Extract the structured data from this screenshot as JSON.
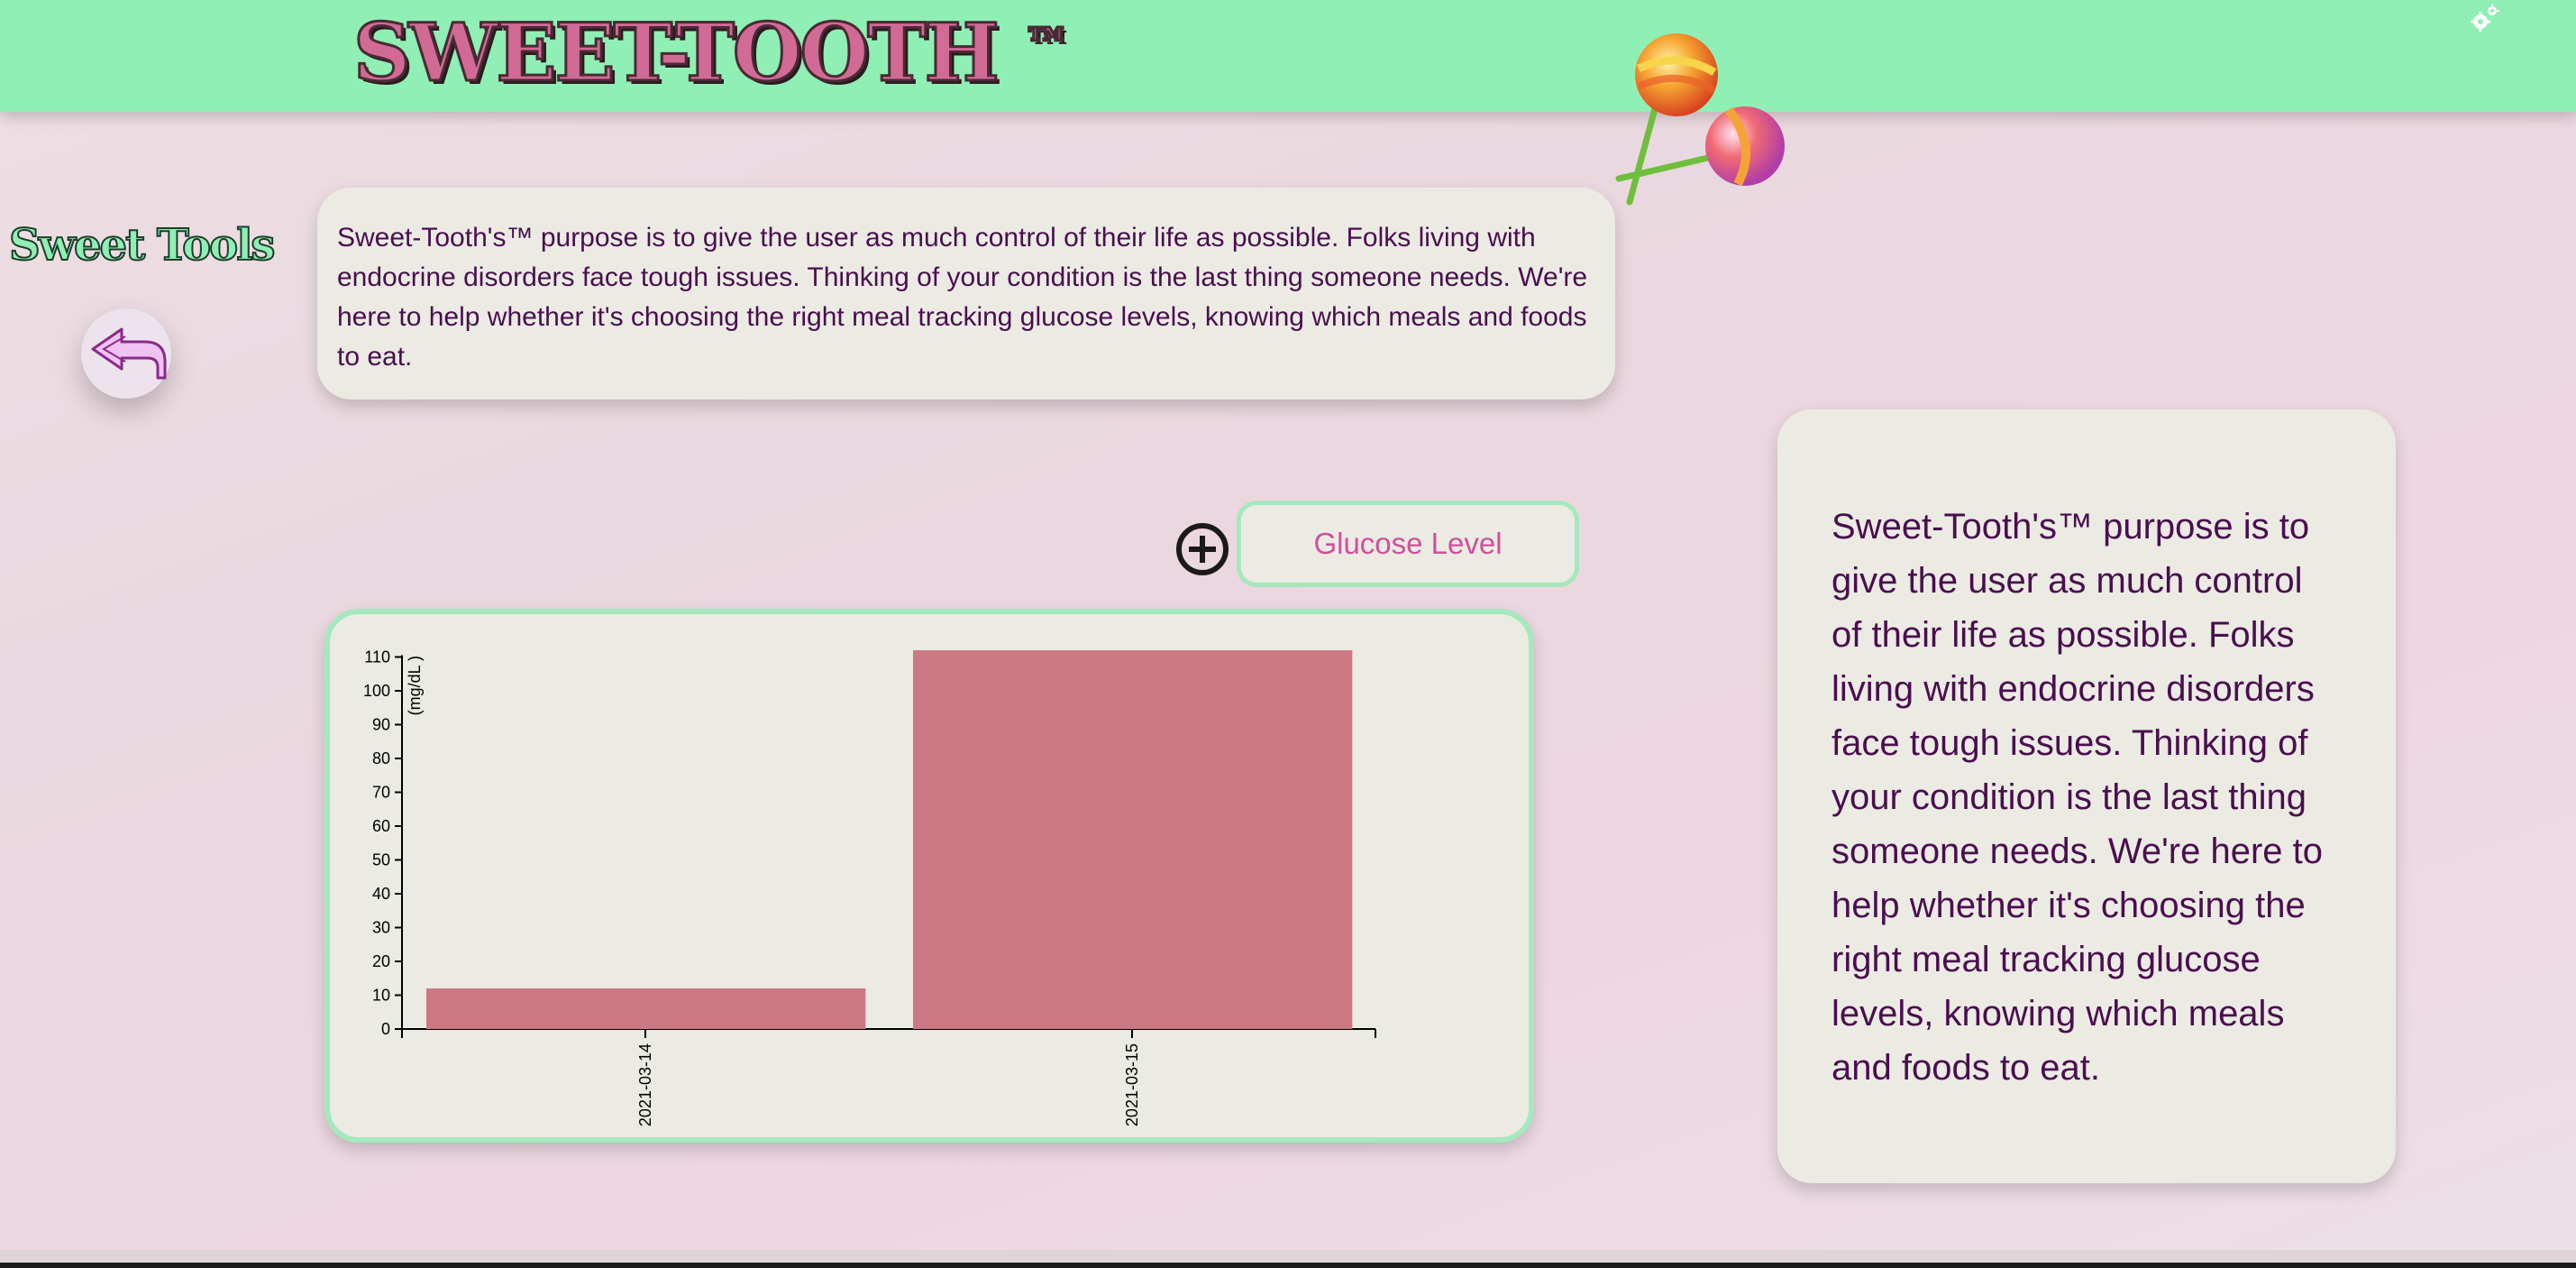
{
  "header": {
    "brand": "SWEET-TOOTH",
    "trademark": "™",
    "settings_icon": "gears-icon",
    "decoration": "lollipops"
  },
  "sidebar": {
    "title": "Sweet Tools",
    "back_icon": "back-arrow-icon"
  },
  "intro_card": {
    "text": "Sweet-Tooth's™ purpose is to give the user as much control of their life as possible. Folks living with endocrine disorders face tough issues. Thinking of your condition is the last thing someone needs. We're here to help whether it's choosing the right meal tracking glucose levels, knowing which meals and foods to eat."
  },
  "controls": {
    "add_icon": "plus-circle-icon",
    "glucose_button": "Glucose Level"
  },
  "side_card": {
    "text": "Sweet-Tooth's™ purpose is to give the user as much control of their life as possible. Folks living with endocrine disorders face tough issues. Thinking of your condition is the last thing someone needs. We're here to help whether it's choosing the right meal tracking glucose levels, knowing which meals and foods to eat."
  },
  "colors": {
    "header": "#8fefb4",
    "bar": "#cd7984",
    "card": "#ebebe4",
    "text": "#4a0e4e",
    "accent": "#d04f9a"
  },
  "chart_data": {
    "type": "bar",
    "categories": [
      "2021-03-14",
      "2021-03-15"
    ],
    "values": [
      12,
      112
    ],
    "ylabel": "(mg/dL )",
    "ylim": [
      0,
      112
    ],
    "yticks": [
      0,
      10,
      20,
      30,
      40,
      50,
      60,
      70,
      80,
      90,
      100,
      110
    ],
    "grid": false
  }
}
